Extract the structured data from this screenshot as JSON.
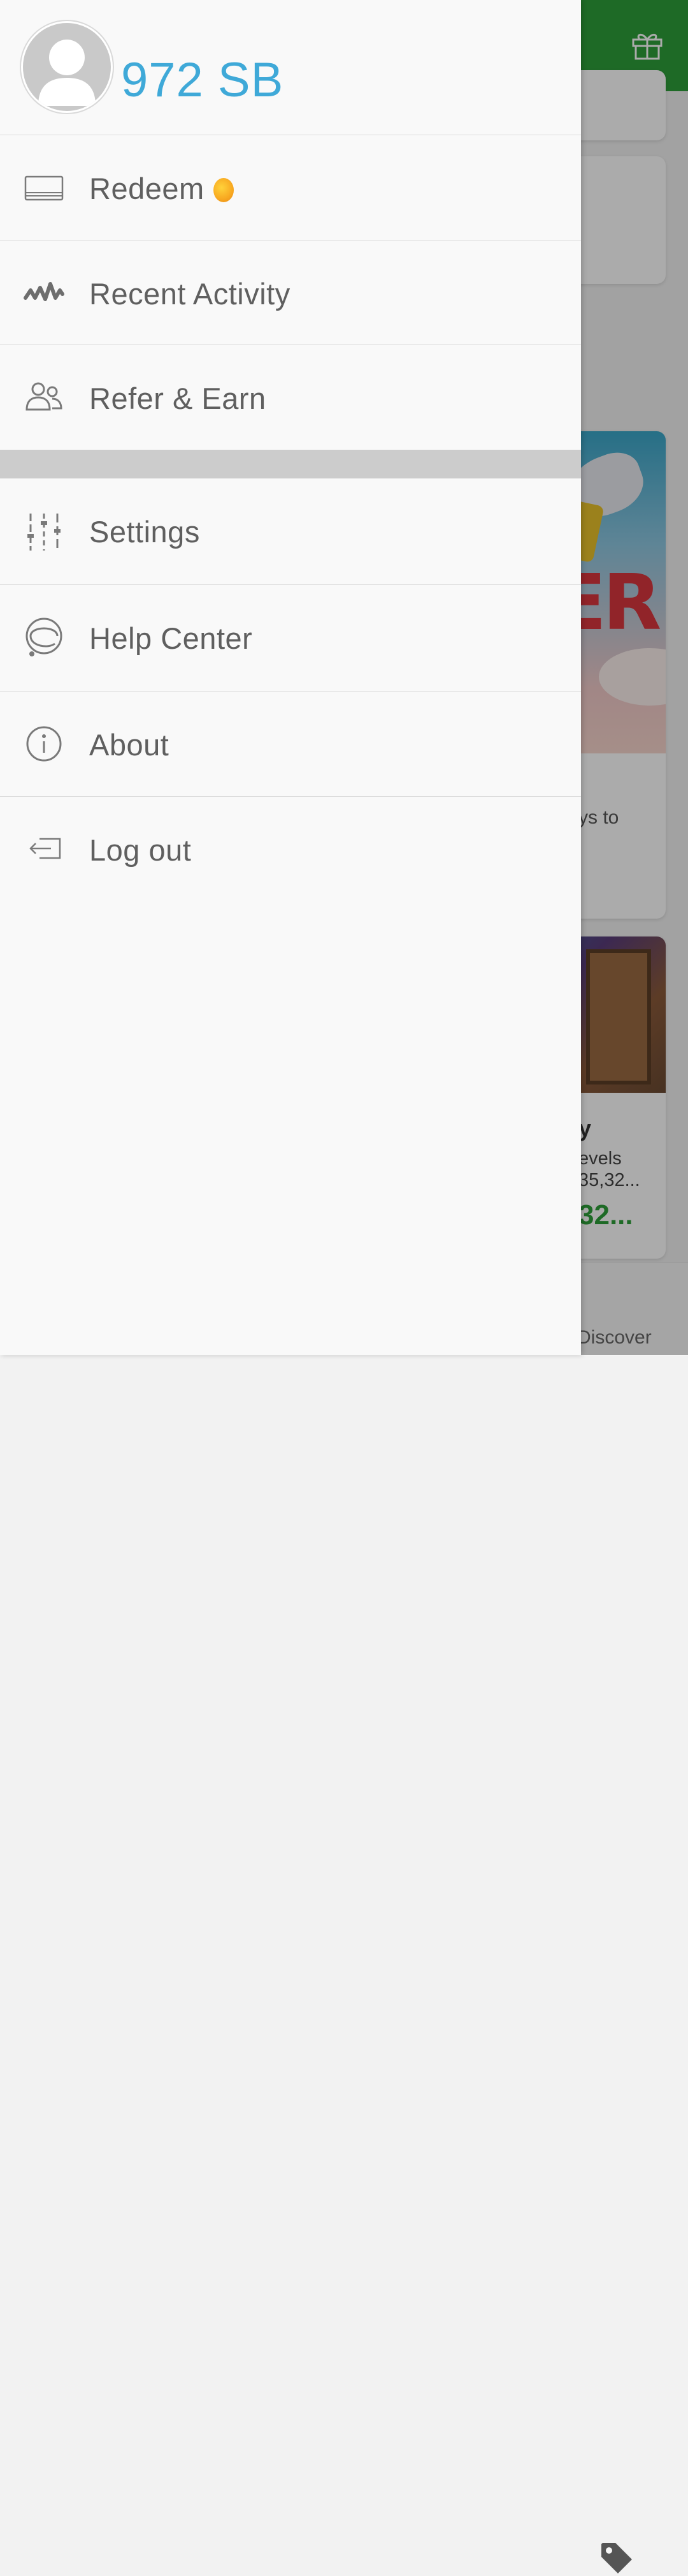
{
  "account": {
    "balance": "972 SB"
  },
  "menu": {
    "redeem": "Redeem",
    "recent_activity": "Recent Activity",
    "refer_earn": "Refer & Earn",
    "settings": "Settings",
    "help_center": "Help Center",
    "about": "About",
    "logout": "Log out"
  },
  "background": {
    "banner_partial_text": "ER",
    "card_text_partial": "ys to",
    "card2_title_partial": "y",
    "card2_line1_partial": "evels",
    "card2_line2_partial": "35,32...",
    "card2_reward_partial": "32...",
    "nav_discover": "Discover"
  },
  "colors": {
    "balance": "#3fa9d8",
    "topbar": "#2e9e3a",
    "menu_text": "#5f5f5f"
  },
  "icons": {
    "avatar": "person-placeholder",
    "redeem": "card-icon",
    "recent_activity": "activity-wave-icon",
    "refer_earn": "people-icon",
    "settings": "sliders-icon",
    "help_center": "headset-icon",
    "about": "info-icon",
    "logout": "logout-icon",
    "topbar": "gift-icon",
    "nav": "tag-icon"
  }
}
